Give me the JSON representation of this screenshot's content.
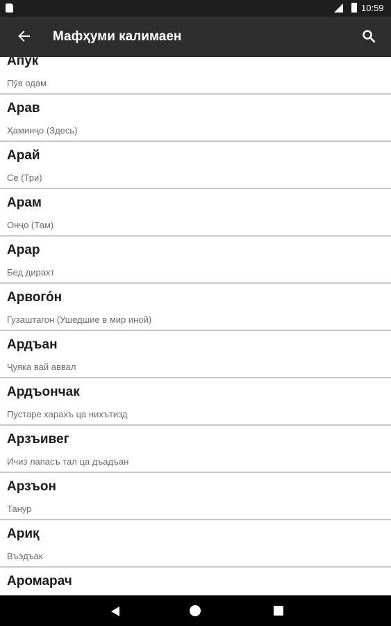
{
  "status_bar": {
    "time": "10:59"
  },
  "toolbar": {
    "title": "Мафҳуми калимаен",
    "back_icon": "arrow-left-icon",
    "search_icon": "search-icon"
  },
  "entries": [
    {
      "word": "Апук",
      "meaning": "Пӯв одам"
    },
    {
      "word": "Арав",
      "meaning": "Ҳаминҷо (Здесь)"
    },
    {
      "word": "Арай",
      "meaning": "Се (Три)"
    },
    {
      "word": "Арам",
      "meaning": "Онҷо (Там)"
    },
    {
      "word": "Арар",
      "meaning": "Бед дирахт"
    },
    {
      "word": "Арвого́н",
      "meaning": "Гузаштагон (Ушедшие в мир иной)"
    },
    {
      "word": "Ардъан",
      "meaning": "Ҷуяка вай аввал"
    },
    {
      "word": "Ардъончак",
      "meaning": "Пустаре харахъ ца нихътизд"
    },
    {
      "word": "Арзъивег",
      "meaning": "Ичиз лапасъ тал ца дъадъан"
    },
    {
      "word": "Арзъон",
      "meaning": "Танур"
    },
    {
      "word": "Ариқ",
      "meaning": "Въэдъак"
    },
    {
      "word": "Аромарач",
      "meaning": ""
    }
  ],
  "nav_bar": {
    "back_icon": "triangle-back-icon",
    "home_icon": "circle-home-icon",
    "recents_icon": "square-recents-icon"
  }
}
